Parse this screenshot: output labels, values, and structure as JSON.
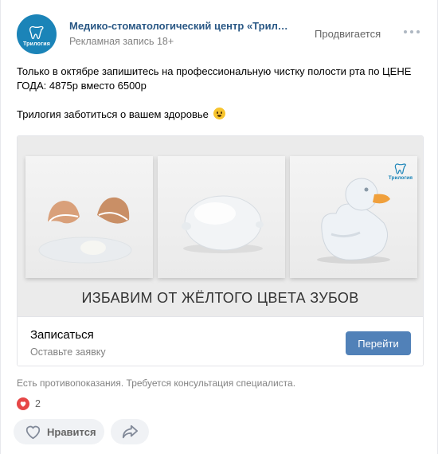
{
  "post": {
    "author": "Медико-стоматологический центр «Трилогия»",
    "ad_label": "Рекламная запись",
    "age_rating": "18+",
    "promoted_label": "Продвигается",
    "avatar_text": "Трилогия",
    "text_line_1": "Только в октябре запишитесь на профессиональную чистку полости рта по ЦЕНЕ ГОДА: 4875р вместо 6500р",
    "text_line_2": "Трилогия заботиться о вашем здоровье"
  },
  "card": {
    "banner_title": "ИЗБАВИМ ОТ ЖЁЛТОГО ЦВЕТА ЗУБОВ",
    "logo_text": "Трилогия",
    "cta_title": "Записаться",
    "cta_subtitle": "Оставьте заявку",
    "cta_button": "Перейти"
  },
  "disclaimer": "Есть противопоказания. Требуется консультация специалиста.",
  "reactions": {
    "count": "2"
  },
  "actions": {
    "like_label": "Нравится"
  },
  "colors": {
    "brand": "#1b84b8",
    "link": "#2a5885",
    "button": "#5181b8",
    "heart": "#e64646"
  },
  "icons": [
    "tooth-logo-icon",
    "more-icon",
    "smile-emoji-icon",
    "heart-icon",
    "like-icon",
    "share-icon"
  ]
}
